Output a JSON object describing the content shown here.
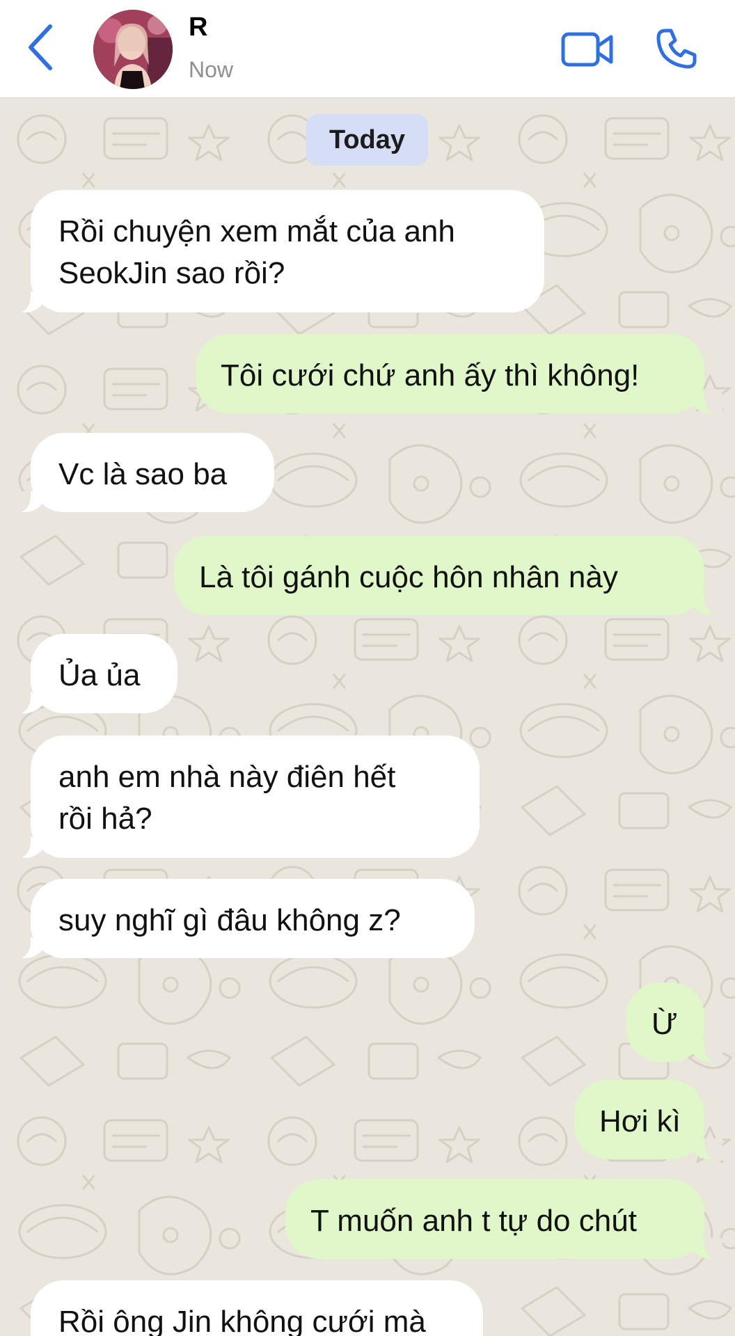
{
  "header": {
    "contact_name": "R",
    "status": "Now"
  },
  "icons": {
    "back": "chevron-left-icon",
    "video": "video-camera-icon",
    "phone": "phone-icon"
  },
  "colors": {
    "accent": "#2f6fe0",
    "incoming_bubble": "#ffffff",
    "outgoing_bubble": "#dff7c9",
    "date_pill": "#d6def5",
    "wallpaper": "#ebe6dd"
  },
  "chat": {
    "date_label": "Today",
    "messages": [
      {
        "direction": "incoming",
        "text": "Rồi chuyện xem mắt của anh\nSeokJin sao rồi?"
      },
      {
        "direction": "outgoing",
        "text": "Tôi cưới chứ anh ấy thì không!"
      },
      {
        "direction": "incoming",
        "text": "Vc là sao ba"
      },
      {
        "direction": "outgoing",
        "text": "Là tôi gánh cuộc hôn nhân này"
      },
      {
        "direction": "incoming",
        "text": "Ủa ủa"
      },
      {
        "direction": "incoming",
        "text": "anh em nhà này điên hết\nrồi hả?"
      },
      {
        "direction": "incoming",
        "text": "suy nghĩ gì đâu không z?"
      },
      {
        "direction": "outgoing",
        "text": "Ừ"
      },
      {
        "direction": "outgoing",
        "text": "Hơi kì"
      },
      {
        "direction": "outgoing",
        "text": "T muốn anh t tự do chút"
      },
      {
        "direction": "incoming",
        "text": "Rồi ông Jin không cưới mà"
      }
    ]
  }
}
